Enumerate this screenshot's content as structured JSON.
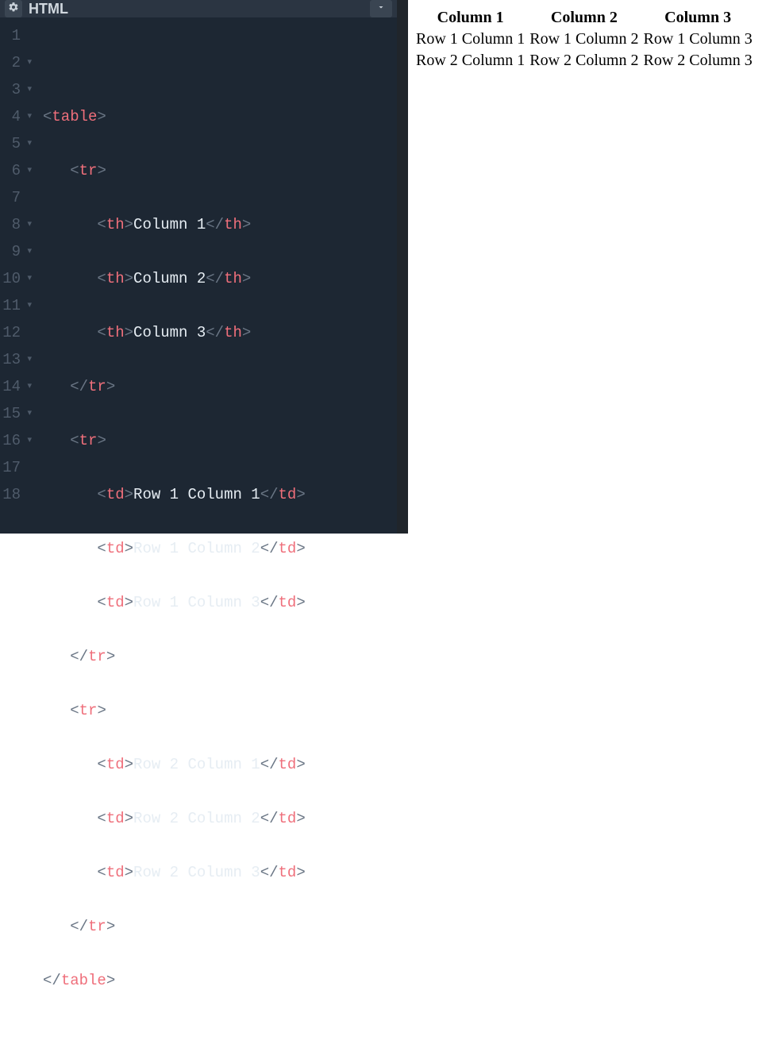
{
  "editor": {
    "panel_title": "HTML",
    "line_numbers": [
      "1",
      "2",
      "3",
      "4",
      "5",
      "6",
      "7",
      "8",
      "9",
      "10",
      "11",
      "12",
      "13",
      "14",
      "15",
      "16",
      "17",
      "18"
    ],
    "fold_markers": [
      false,
      true,
      true,
      true,
      true,
      true,
      false,
      true,
      true,
      true,
      true,
      false,
      true,
      true,
      true,
      true,
      false,
      false
    ],
    "code": {
      "l1": "",
      "l2": {
        "open": "<",
        "tag": "table",
        "close": ">"
      },
      "l3": {
        "open": "<",
        "tag": "tr",
        "close": ">"
      },
      "l4": {
        "open": "<",
        "tag": "th",
        "close": ">",
        "text": "Column 1",
        "copen": "</",
        "ctag": "th",
        "cclose": ">"
      },
      "l5": {
        "open": "<",
        "tag": "th",
        "close": ">",
        "text": "Column 2",
        "copen": "</",
        "ctag": "th",
        "cclose": ">"
      },
      "l6": {
        "open": "<",
        "tag": "th",
        "close": ">",
        "text": "Column 3",
        "copen": "</",
        "ctag": "th",
        "cclose": ">"
      },
      "l7": {
        "copen": "</",
        "ctag": "tr",
        "cclose": ">"
      },
      "l8": {
        "open": "<",
        "tag": "tr",
        "close": ">"
      },
      "l9": {
        "open": "<",
        "tag": "td",
        "close": ">",
        "text": "Row 1 Column 1",
        "copen": "</",
        "ctag": "td",
        "cclose": ">"
      },
      "l10": {
        "open": "<",
        "tag": "td",
        "close": ">",
        "text": "Row 1 Column 2",
        "copen": "</",
        "ctag": "td",
        "cclose": ">"
      },
      "l11": {
        "open": "<",
        "tag": "td",
        "close": ">",
        "text": "Row 1 Column 3",
        "copen": "</",
        "ctag": "td",
        "cclose": ">"
      },
      "l12": {
        "copen": "</",
        "ctag": "tr",
        "cclose": ">"
      },
      "l13": {
        "open": "<",
        "tag": "tr",
        "close": ">"
      },
      "l14": {
        "open": "<",
        "tag": "td",
        "close": ">",
        "text": "Row 2 Column 1",
        "copen": "</",
        "ctag": "td",
        "cclose": ">"
      },
      "l15": {
        "open": "<",
        "tag": "td",
        "close": ">",
        "text": "Row 2 Column 2",
        "copen": "</",
        "ctag": "td",
        "cclose": ">"
      },
      "l16": {
        "open": "<",
        "tag": "td",
        "close": ">",
        "text": "Row 2 Column 3",
        "copen": "</",
        "ctag": "td",
        "cclose": ">"
      },
      "l17": {
        "copen": "</",
        "ctag": "tr",
        "cclose": ">"
      },
      "l18": {
        "copen": "</",
        "ctag": "table",
        "cclose": ">"
      }
    },
    "indent": {
      "l1": "",
      "l2": "",
      "l3": "   ",
      "l4": "      ",
      "l5": "      ",
      "l6": "      ",
      "l7": "   ",
      "l8": "   ",
      "l9": "      ",
      "l10": "      ",
      "l11": "      ",
      "l12": "   ",
      "l13": "   ",
      "l14": "      ",
      "l15": "      ",
      "l16": "      ",
      "l17": "   ",
      "l18": ""
    }
  },
  "preview": {
    "headers": [
      "Column 1",
      "Column 2",
      "Column 3"
    ],
    "rows": [
      [
        "Row 1 Column 1",
        "Row 1 Column 2",
        "Row 1 Column 3"
      ],
      [
        "Row 2 Column 1",
        "Row 2 Column 2",
        "Row 2 Column 3"
      ]
    ]
  }
}
